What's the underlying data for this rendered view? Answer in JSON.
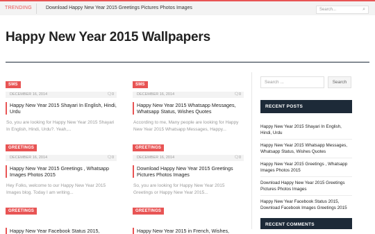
{
  "topbar": {
    "trending_label": "TRENDING",
    "ticker_text": "Download Happy New Year 2015 Greetings Pictures Photos Images",
    "search_placeholder": "Search..."
  },
  "page": {
    "title": "Happy New Year 2015 Wallpapers"
  },
  "posts": [
    {
      "category": "SMS",
      "date": "DECEMBER 16, 2014",
      "comments": "0",
      "title": "Happy New Year 2015 Shayari In English, Hindi, Urdu",
      "excerpt": "So, you are looking for Happy New Year 2015 Shayari In English, Hindi, Urdu?. Yeah,..."
    },
    {
      "category": "SMS",
      "date": "DECEMBER 16, 2014",
      "comments": "0",
      "title": "Happy New Year 2015 Whatsapp Messages, Whatsapp Status, Wishes Quotes",
      "excerpt": "According to me, Many people are looking for Happy New Year 2015 Whatsapp Messages, Happy..."
    },
    {
      "category": "GREETINGS",
      "date": "DECEMBER 16, 2014",
      "comments": "0",
      "title": "Happy New Year 2015 Greetings , Whatsapp Images Photos 2015",
      "excerpt": "Hey Folks, welcome to our Happy New Year 2015 Images blog. Today I am writing..."
    },
    {
      "category": "GREETINGS",
      "date": "DECEMBER 16, 2014",
      "comments": "0",
      "title": "Download Happy New Year 2015 Greetings Pictures Photos Images",
      "excerpt": "So, you are looking for Happy New Year 2015 Greetings or Happy New Year 2015..."
    },
    {
      "category": "GREETINGS",
      "date": "",
      "comments": "",
      "title": "Happy New Year Facebook Status 2015,",
      "excerpt": ""
    },
    {
      "category": "GREETINGS",
      "date": "",
      "comments": "",
      "title": "Happy New Year 2015 in French, Wishes,",
      "excerpt": ""
    }
  ],
  "sidebar": {
    "search_placeholder": "Search ...",
    "search_button": "Search",
    "recent_posts_heading": "RECENT POSTS",
    "recent_posts": [
      "Happy New Year 2015 Shayari In English, Hindi, Urdu",
      "Happy New Year 2015 Whatsapp Messages, Whatsapp Status, Wishes Quotes",
      "Happy New Year 2015 Greetings , Whatsapp Images Photos 2015",
      "Download Happy New Year 2015 Greetings Pictures Photos Images",
      "Happy New Year Facebook Status 2015, Download Facebook Images Greetings 2015"
    ],
    "recent_comments_heading": "RECENT COMMENTS"
  },
  "icons": {
    "comment": "comment-icon",
    "search": "search-icon"
  },
  "colors": {
    "accent": "#e85454",
    "dark": "#1d2a38"
  }
}
